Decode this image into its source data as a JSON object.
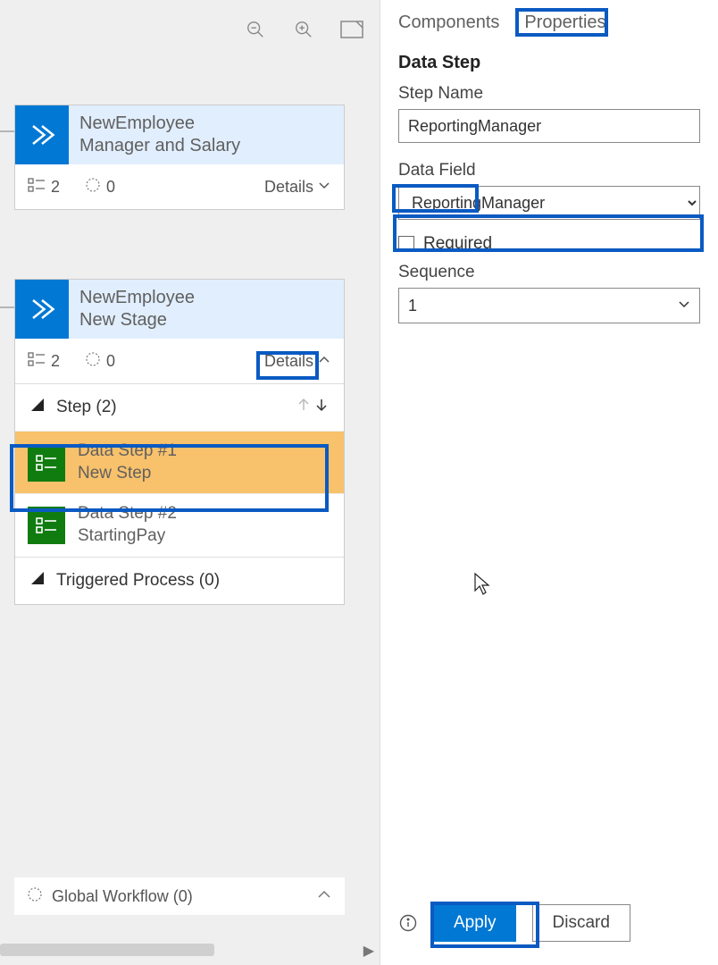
{
  "toolbar": {
    "zoom_out_icon": "zoom-out",
    "zoom_in_icon": "zoom-in",
    "fit_icon": "fit-screen"
  },
  "stages": [
    {
      "entity": "NewEmployee",
      "name": "Manager and Salary",
      "steps_count": "2",
      "workflows_count": "0",
      "details_label": "Details",
      "expanded": false
    },
    {
      "entity": "NewEmployee",
      "name": "New Stage",
      "steps_count": "2",
      "workflows_count": "0",
      "details_label": "Details",
      "expanded": true,
      "step_header": "Step (2)",
      "items": [
        {
          "title": "Data Step #1",
          "sub": "New Step",
          "active": true
        },
        {
          "title": "Data Step #2",
          "sub": "StartingPay",
          "active": false
        }
      ],
      "triggered_label": "Triggered Process (0)"
    }
  ],
  "global_bar": {
    "label": "Global Workflow (0)"
  },
  "panel": {
    "tabs": {
      "components": "Components",
      "properties": "Properties",
      "active": "properties"
    },
    "section_title": "Data Step",
    "step_name_label": "Step Name",
    "step_name_value": "ReportingManager",
    "data_field_label": "Data Field",
    "data_field_value": "ReportingManager",
    "required_label": "Required",
    "required_checked": false,
    "sequence_label": "Sequence",
    "sequence_value": "1",
    "apply_label": "Apply",
    "discard_label": "Discard"
  }
}
